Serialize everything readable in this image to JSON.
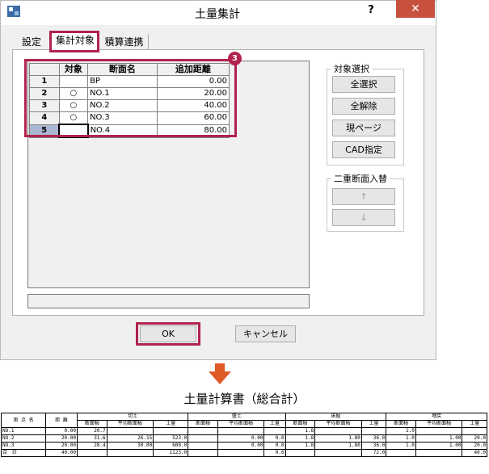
{
  "window": {
    "title": "土量集計",
    "help_label": "?",
    "close_label": "✕"
  },
  "tabs": [
    {
      "label": "設定"
    },
    {
      "label": "集計対象"
    },
    {
      "label": "積算連携"
    }
  ],
  "grid": {
    "headers": {
      "target": "対象",
      "name": "断面名",
      "distance": "追加距離"
    },
    "rows": [
      {
        "no": "1",
        "target": "",
        "name": "BP",
        "distance": "0.00"
      },
      {
        "no": "2",
        "target": "○",
        "name": "NO.1",
        "distance": "20.00"
      },
      {
        "no": "3",
        "target": "○",
        "name": "NO.2",
        "distance": "40.00"
      },
      {
        "no": "4",
        "target": "○",
        "name": "NO.3",
        "distance": "60.00"
      },
      {
        "no": "5",
        "target": "",
        "name": "NO.4",
        "distance": "80.00"
      }
    ]
  },
  "callout": "3",
  "target_group": {
    "label": "対象選択",
    "buttons": [
      "全選択",
      "全解除",
      "現ページ",
      "CAD指定"
    ]
  },
  "swap_group": {
    "label": "二重断面入替",
    "up": "↑",
    "down": "↓"
  },
  "buttons": {
    "ok": "OK",
    "cancel": "キャンセル"
  },
  "colors": {
    "highlight": "#b0234d",
    "arrow": "#e05a28",
    "close": "#c7503e"
  },
  "report": {
    "title": "土量計算書（総合計）",
    "headers": {
      "station": "測 点 名",
      "distance": "距 離",
      "groups": [
        "切土",
        "盛土",
        "床掘",
        "埋戻"
      ],
      "sub": [
        "断面積",
        "平均断面積",
        "土量"
      ]
    },
    "rows": [
      {
        "station": "NO.1",
        "distance": "0.00",
        "v": [
          "20.7",
          "",
          "",
          "",
          "",
          "",
          "1.8",
          "",
          "",
          "1.0",
          "",
          ""
        ]
      },
      {
        "station": "NO.2",
        "distance": "20.00",
        "v": [
          "31.6",
          "26.15",
          "523.0",
          "",
          "0.00",
          "0.0",
          "1.8",
          "1.80",
          "36.0",
          "1.0",
          "1.00",
          "20.0"
        ]
      },
      {
        "station": "NO.3",
        "distance": "20.00",
        "v": [
          "28.4",
          "30.00",
          "600.0",
          "",
          "0.00",
          "0.0",
          "1.8",
          "1.80",
          "36.0",
          "1.0",
          "1.00",
          "20.0"
        ]
      },
      {
        "station": "合　計",
        "distance": "40.00",
        "v": [
          "",
          "",
          "1123.0",
          "",
          "",
          "0.0",
          "",
          "",
          "72.0",
          "",
          "",
          "40.0"
        ]
      }
    ]
  }
}
